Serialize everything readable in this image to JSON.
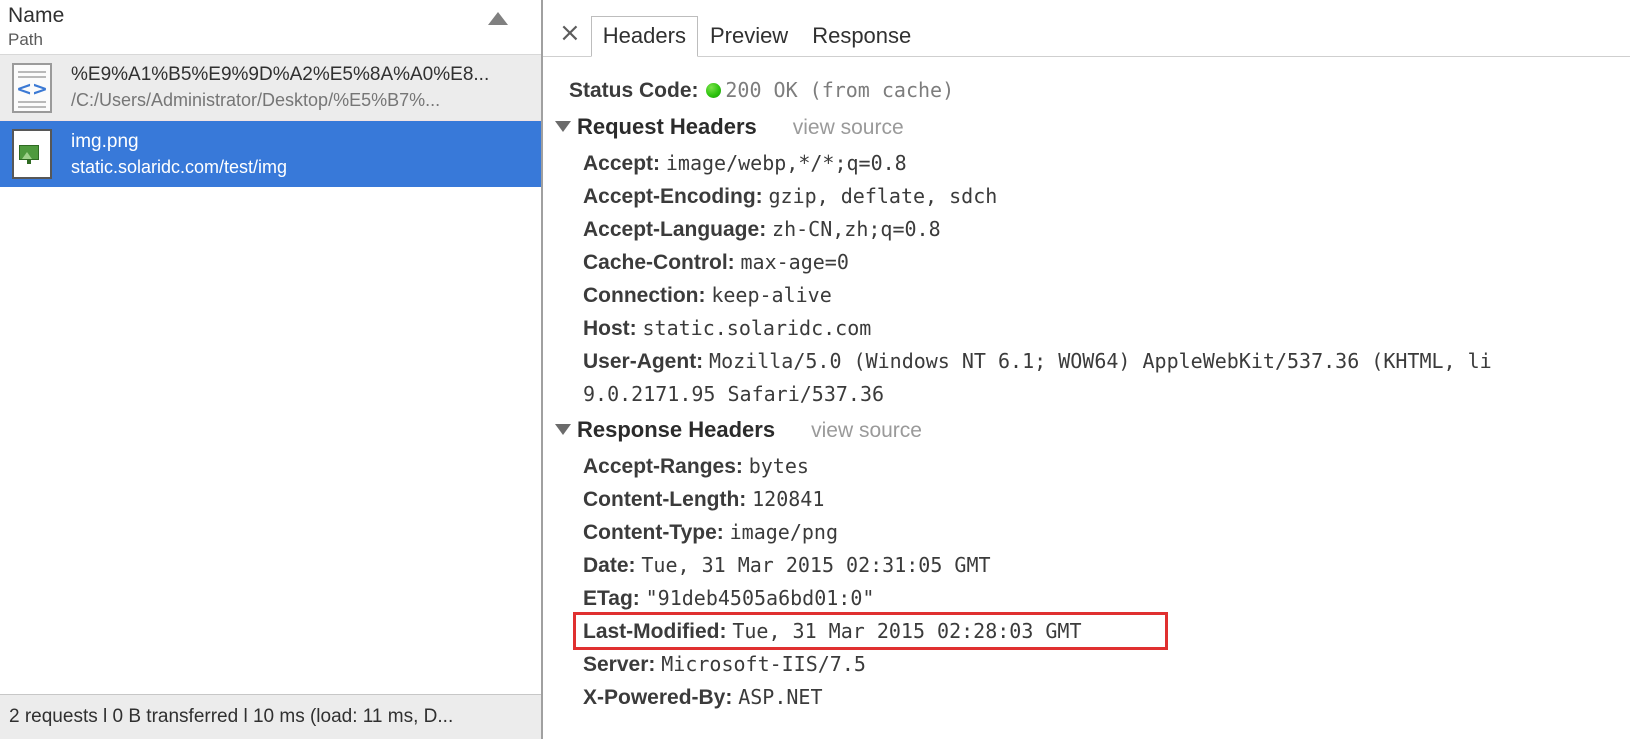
{
  "left_panel": {
    "columns": {
      "name": "Name",
      "path": "Path",
      "sort_icon": "sort-ascending-triangle-icon"
    },
    "requests": [
      {
        "icon": "document-code-icon",
        "name": "%E9%A1%B5%E9%9D%A2%E5%8A%A0%E8...",
        "path": "/C:/Users/Administrator/Desktop/%E5%B7%..."
      },
      {
        "icon": "image-file-icon",
        "name": "img.png",
        "path": "static.solaridc.com/test/img"
      }
    ],
    "status_bar": "2 requests l 0 B transferred l 10 ms (load: 11 ms, D..."
  },
  "right_panel": {
    "close_label": "×",
    "tabs": [
      {
        "label": "Headers",
        "active": true
      },
      {
        "label": "Preview",
        "active": false
      },
      {
        "label": "Response",
        "active": false
      }
    ],
    "clipped_fragment": ".",
    "status_code": {
      "key": "Status Code:",
      "dot": "green-status-dot-icon",
      "value": "200 OK (from cache)"
    },
    "request_headers": {
      "title": "Request Headers",
      "view_source": "view source",
      "rows": [
        {
          "key": "Accept:",
          "value": "image/webp,*/*;q=0.8"
        },
        {
          "key": "Accept-Encoding:",
          "value": "gzip, deflate, sdch"
        },
        {
          "key": "Accept-Language:",
          "value": "zh-CN,zh;q=0.8"
        },
        {
          "key": "Cache-Control:",
          "value": "max-age=0"
        },
        {
          "key": "Connection:",
          "value": "keep-alive"
        },
        {
          "key": "Host:",
          "value": "static.solaridc.com"
        },
        {
          "key": "User-Agent:",
          "value": "Mozilla/5.0 (Windows NT 6.1; WOW64) AppleWebKit/537.36 (KHTML, li"
        }
      ],
      "user_agent_wrap": "9.0.2171.95 Safari/537.36"
    },
    "response_headers": {
      "title": "Response Headers",
      "view_source": "view source",
      "rows": [
        {
          "key": "Accept-Ranges:",
          "value": "bytes"
        },
        {
          "key": "Content-Length:",
          "value": "120841"
        },
        {
          "key": "Content-Type:",
          "value": "image/png"
        },
        {
          "key": "Date:",
          "value": "Tue, 31 Mar 2015 02:31:05 GMT"
        },
        {
          "key": "ETag:",
          "value": "\"91deb4505a6bd01:0\""
        },
        {
          "key": "Last-Modified:",
          "value": "Tue, 31 Mar 2015 02:28:03 GMT",
          "highlighted": true
        },
        {
          "key": "Server:",
          "value": "Microsoft-IIS/7.5"
        },
        {
          "key": "X-Powered-By:",
          "value": "ASP.NET"
        }
      ]
    },
    "annotation": {
      "type": "red-rectangle-highlight",
      "color": "#e03030",
      "target": "Last-Modified"
    }
  }
}
